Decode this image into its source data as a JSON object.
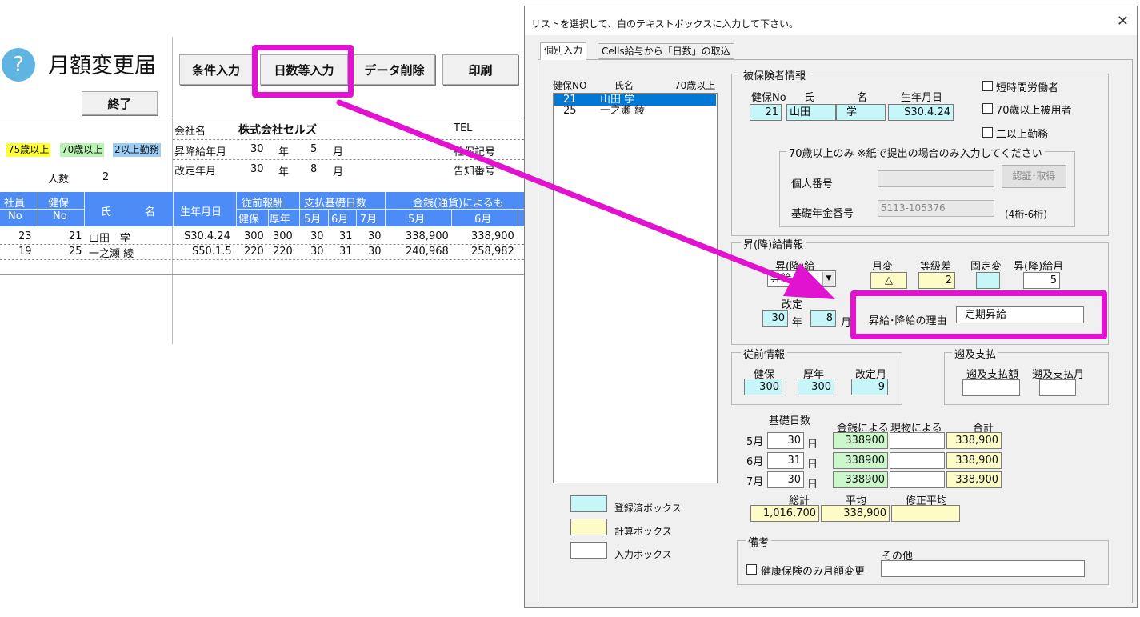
{
  "sheet": {
    "help_icon": "?",
    "title": "月額変更届",
    "buttons": {
      "condition": "条件入力",
      "days": "日数等入力",
      "delete": "データ削除",
      "print": "印刷",
      "exit": "終了"
    },
    "legend": {
      "age75": "75歳以上",
      "age70": "70歳以上",
      "multi": "2以上勤務"
    },
    "people_label": "人数",
    "people_count": "2",
    "company_label": "会社名",
    "company_name": "株式会社セルズ",
    "tel_label": "TEL",
    "raise_label": "昇降給年月",
    "raise_year": "30",
    "raise_month": "5",
    "revise_label": "改定年月",
    "revise_year": "30",
    "revise_month": "8",
    "year_unit": "年",
    "month_unit": "月",
    "insurance_code_label": "社保記号",
    "notice_label": "告知番号",
    "headers": {
      "employee": "社員",
      "no": "No",
      "kenpo": "健保",
      "name_a": "氏",
      "name_b": "名",
      "birth": "生年月日",
      "prev_pay": "従前報酬",
      "pay_days": "支払基礎日数",
      "money": "金銭(通貨)によるも",
      "kenpo2": "健保",
      "kounen": "厚年",
      "m5": "5月",
      "m6": "6月",
      "m7": "7月",
      "mm5": "5月",
      "mm6": "6月"
    },
    "rows": [
      {
        "emp_no": "23",
        "kenpo_no": "21",
        "name": "山田　学",
        "birth": "S30.4.24",
        "kenpo": "300",
        "kounen": "300",
        "d5": "30",
        "d6": "31",
        "d7": "30",
        "m5": "338,900",
        "m6": "338,900"
      },
      {
        "emp_no": "19",
        "kenpo_no": "25",
        "name": "一之瀬 綾",
        "birth": "S50.1.5",
        "kenpo": "220",
        "kounen": "220",
        "d5": "30",
        "d6": "31",
        "d7": "30",
        "m5": "240,968",
        "m6": "258,982"
      }
    ]
  },
  "dialog": {
    "title": "リストを選択して、白のテキストボックスに入力して下さい。",
    "close_icon": "close-icon",
    "tabs": [
      "個別入力",
      "Cells給与から「日数」の取込"
    ],
    "list_headers": {
      "no": "健保NO",
      "name": "氏名",
      "age70": "70歳以上"
    },
    "list_items": [
      {
        "no": "21",
        "name": "山田 学",
        "selected": true
      },
      {
        "no": "25",
        "name": "一之瀬 綾",
        "selected": false
      }
    ],
    "insured": {
      "group": "被保険者情報",
      "no_label": "健保No",
      "sei_label": "氏",
      "mei_label": "名",
      "birth_label": "生年月日",
      "no": "21",
      "sei": "山田",
      "mei": "学",
      "birth": "S30.4.24",
      "chk_short": "短時間労働者",
      "chk_70": "70歳以上被用者",
      "chk_multi": "二以上勤務"
    },
    "age70": {
      "group": "70歳以上のみ ※紙で提出の場合のみ入力してください",
      "mynumber_label": "個人番号",
      "mynumber": "",
      "auth_button": "認証･取得",
      "pension_label": "基礎年金番号",
      "pension_number": "5113-105376",
      "pension_hint": "(4桁-6桁)"
    },
    "raise": {
      "group": "昇(降)給情報",
      "type_label": "昇(降)給",
      "type_value": "昇給",
      "monthly_change_label": "月変",
      "monthly_change_value": "△",
      "grade_diff_label": "等級差",
      "grade_diff_value": "2",
      "fixed_change_label": "固定変",
      "fixed_change_value": "",
      "raise_month_label": "昇(降)給月",
      "raise_month_value": "5",
      "revise_label": "改定",
      "revise_year": "30",
      "year_unit": "年",
      "revise_month": "8",
      "month_unit": "月",
      "reason_label": "昇給･降給の理由",
      "reason_value": "定期昇給"
    },
    "previous": {
      "group": "従前情報",
      "kenpo_label": "健保",
      "kounen_label": "厚年",
      "revise_month_label": "改定月",
      "kenpo": "300",
      "kounen": "300",
      "revise_month": "9"
    },
    "retro": {
      "group": "遡及支払",
      "amount_label": "遡及支払額",
      "month_label": "遡及支払月",
      "amount": "",
      "month": ""
    },
    "days": {
      "header_days": "基礎日数",
      "header_money": "金銭による",
      "header_goods": "現物による",
      "header_total": "合計",
      "day_unit": "日",
      "rows": [
        {
          "month": "5月",
          "days": "30",
          "money": "338900",
          "goods": "",
          "total": "338,900"
        },
        {
          "month": "6月",
          "days": "31",
          "money": "338900",
          "goods": "",
          "total": "338,900"
        },
        {
          "month": "7月",
          "days": "30",
          "money": "338900",
          "goods": "",
          "total": "338,900"
        }
      ],
      "sum_label": "総計",
      "avg_label": "平均",
      "fixed_avg_label": "修正平均",
      "sum": "1,016,700",
      "avg": "338,900",
      "fixed_avg": ""
    },
    "legend": {
      "registered": "登録済ボックス",
      "calculated": "計算ボックス",
      "input": "入力ボックス"
    },
    "remarks": {
      "group": "備考",
      "chk_label": "健康保険のみ月額変更",
      "other_label": "その他",
      "other_value": ""
    }
  },
  "colors": {
    "highlight": "#e112d0",
    "header_blue": "#4d8cf7",
    "registered_cyan": "#c6f6f8",
    "calc_yellow": "#fdfbc6",
    "money_green": "#cbf7cb"
  }
}
